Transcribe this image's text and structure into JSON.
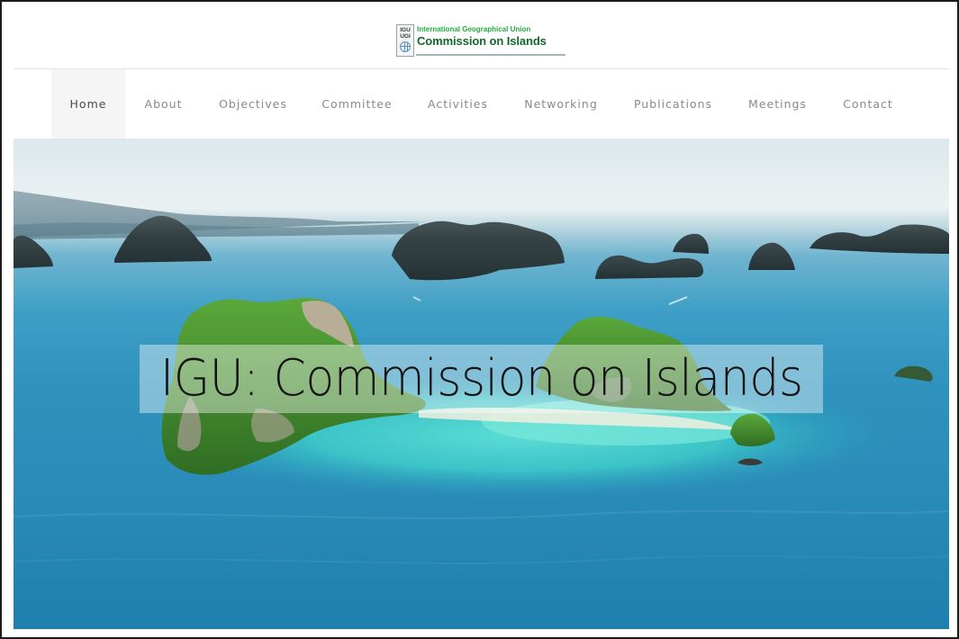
{
  "logo": {
    "badge_line1": "IGU",
    "badge_line2": "UGI",
    "org_name": "International Geographical Union",
    "commission": "Commission on Islands"
  },
  "nav": {
    "items": [
      {
        "label": "Home",
        "active": true
      },
      {
        "label": "About",
        "active": false
      },
      {
        "label": "Objectives",
        "active": false
      },
      {
        "label": "Committee",
        "active": false
      },
      {
        "label": "Activities",
        "active": false
      },
      {
        "label": "Networking",
        "active": false
      },
      {
        "label": "Publications",
        "active": false
      },
      {
        "label": "Meetings",
        "active": false
      },
      {
        "label": "Contact",
        "active": false
      }
    ]
  },
  "hero": {
    "title": "IGU: Commission on Islands",
    "image": "tropical-islands-aerial-photo"
  }
}
